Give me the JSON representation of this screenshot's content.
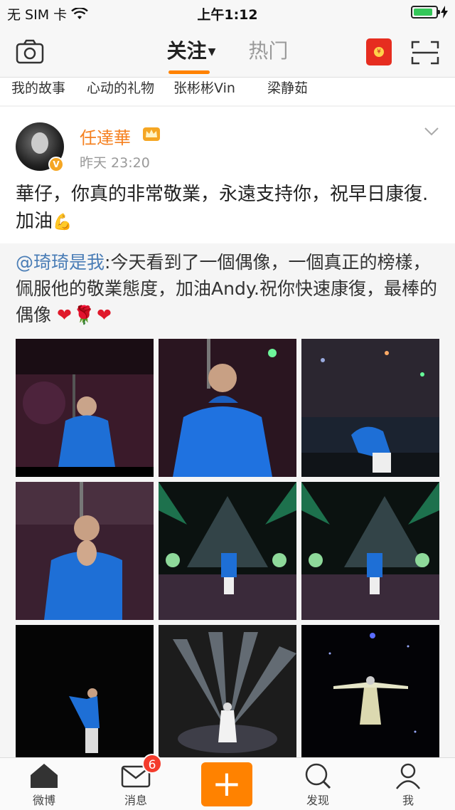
{
  "status_bar": {
    "carrier": "无 SIM 卡",
    "time": "上午1:12",
    "battery_fraction": 0.85
  },
  "nav": {
    "tab_follow": "关注",
    "tab_hot": "热门",
    "redpack_coin": "¥",
    "accent_color": "#ff8200"
  },
  "chips": [
    "我的故事",
    "心动的礼物",
    "张彬彬Vin",
    "梁静茹"
  ],
  "post": {
    "username": "任達華",
    "verified_badge": "V",
    "time": "昨天 23:20",
    "text": "華仔，你真的非常敬業，永遠支持你，祝早日康復.加油",
    "text_emoji": "💪",
    "repost": {
      "mention": "@琦琦是我",
      "text": ":今天看到了一個偶像，一個真正的榜樣，佩服他的敬業態度，加油Andy.祝你快速康復，最棒的偶像 ",
      "emojis": "❤🌹❤"
    }
  },
  "tabbar": {
    "home": "微博",
    "messages": "消息",
    "messages_badge": "6",
    "compose": "+",
    "discover": "发现",
    "me": "我"
  }
}
